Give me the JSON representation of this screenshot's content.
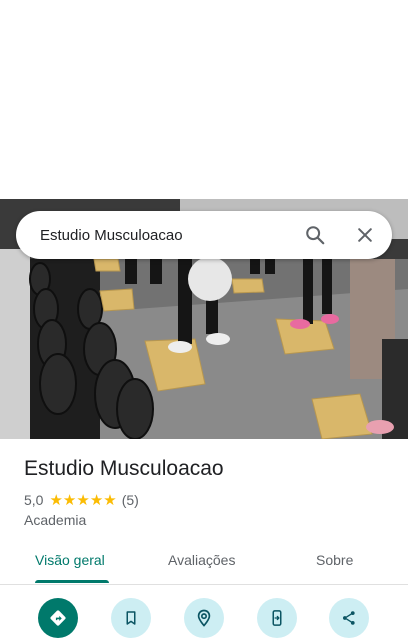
{
  "search": {
    "query": "Estudio Musculoacao",
    "search_icon": "search-icon",
    "close_icon": "close-icon"
  },
  "place": {
    "name": "Estudio Musculoacao",
    "rating": "5,0",
    "stars": 5,
    "review_count": "(5)",
    "category": "Academia"
  },
  "tabs": [
    {
      "label": "Visão geral",
      "active": true
    },
    {
      "label": "Avaliações",
      "active": false
    },
    {
      "label": "Sobre",
      "active": false
    }
  ],
  "actions": [
    {
      "icon": "directions-icon"
    },
    {
      "icon": "bookmark-icon"
    },
    {
      "icon": "nearby-icon"
    },
    {
      "icon": "send-to-phone-icon"
    },
    {
      "icon": "share-icon"
    }
  ],
  "colors": {
    "accent": "#00796b",
    "action_bg": "#cdeef3",
    "star": "#fbbc04"
  }
}
